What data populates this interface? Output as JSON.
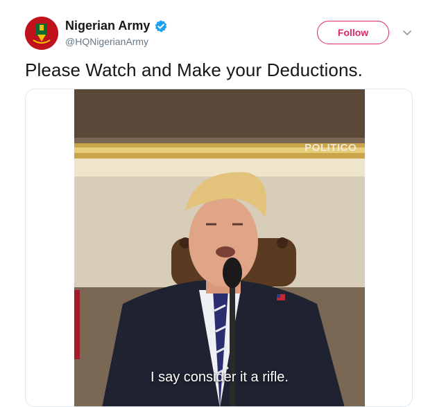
{
  "account": {
    "display_name": "Nigerian Army",
    "handle": "@HQNigerianArmy",
    "verified": true,
    "avatar_icon": "nigerian-army-crest"
  },
  "actions": {
    "follow_label": "Follow",
    "menu_icon": "chevron-down-icon"
  },
  "tweet": {
    "text": "Please Watch and Make your Deductions."
  },
  "video": {
    "watermark": "POLITICO",
    "subtitle": "I say consider it a rifle."
  },
  "colors": {
    "follow_accent": "#e0245e",
    "verified_blue": "#1da1f2",
    "handle_gray": "#657786",
    "avatar_red": "#c0121c"
  }
}
